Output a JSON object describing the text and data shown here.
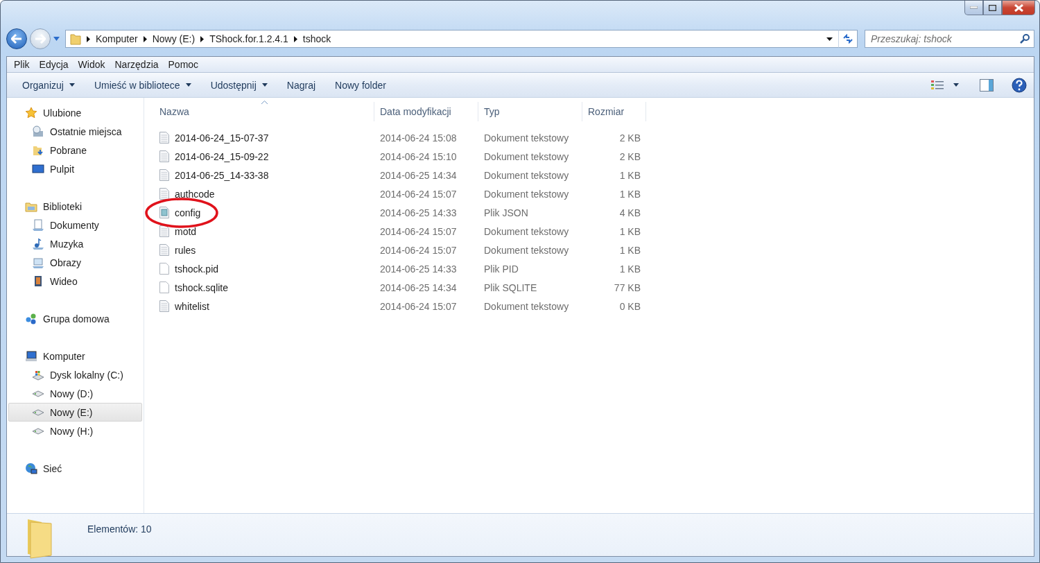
{
  "address_bar": {
    "breadcrumbs": [
      "Komputer",
      "Nowy (E:)",
      "TShock.for.1.2.4.1",
      "tshock"
    ]
  },
  "search": {
    "placeholder": "Przeszukaj: tshock"
  },
  "menu_bar": [
    "Plik",
    "Edycja",
    "Widok",
    "Narzędzia",
    "Pomoc"
  ],
  "toolbar": [
    {
      "label": "Organizuj",
      "dropdown": true
    },
    {
      "label": "Umieść w bibliotece",
      "dropdown": true
    },
    {
      "label": "Udostępnij",
      "dropdown": true
    },
    {
      "label": "Nagraj",
      "dropdown": false
    },
    {
      "label": "Nowy folder",
      "dropdown": false
    }
  ],
  "sidebar": {
    "groups": [
      {
        "label": "Ulubione",
        "kind": "star",
        "items": [
          {
            "label": "Ostatnie miejsca",
            "kind": "recent",
            "selected": false
          },
          {
            "label": "Pobrane",
            "kind": "download",
            "selected": false
          },
          {
            "label": "Pulpit",
            "kind": "desktop",
            "selected": false
          }
        ]
      },
      {
        "label": "Biblioteki",
        "kind": "library",
        "items": [
          {
            "label": "Dokumenty",
            "kind": "docs",
            "selected": false
          },
          {
            "label": "Muzyka",
            "kind": "music",
            "selected": false
          },
          {
            "label": "Obrazy",
            "kind": "pictures",
            "selected": false
          },
          {
            "label": "Wideo",
            "kind": "video",
            "selected": false
          }
        ]
      },
      {
        "label": "Grupa domowa",
        "kind": "homegroup"
      },
      {
        "label": "Komputer",
        "kind": "computer",
        "items": [
          {
            "label": "Dysk lokalny (C:)",
            "kind": "system-drive",
            "selected": false
          },
          {
            "label": "Nowy (D:)",
            "kind": "drive",
            "selected": false
          },
          {
            "label": "Nowy (E:)",
            "kind": "drive",
            "selected": true
          },
          {
            "label": "Nowy (H:)",
            "kind": "drive",
            "selected": false
          }
        ]
      },
      {
        "label": "Sieć",
        "kind": "network"
      }
    ]
  },
  "table": {
    "columns": [
      "Nazwa",
      "Data modyfikacji",
      "Typ",
      "Rozmiar"
    ],
    "rows": [
      {
        "name": "2014-06-24_15-07-37",
        "modified": "2014-06-24 15:08",
        "type": "Dokument tekstowy",
        "size": "2 KB",
        "kind": "text",
        "circled": false
      },
      {
        "name": "2014-06-24_15-09-22",
        "modified": "2014-06-24 15:10",
        "type": "Dokument tekstowy",
        "size": "2 KB",
        "kind": "text",
        "circled": false
      },
      {
        "name": "2014-06-25_14-33-38",
        "modified": "2014-06-25 14:34",
        "type": "Dokument tekstowy",
        "size": "1 KB",
        "kind": "text",
        "circled": false
      },
      {
        "name": "authcode",
        "modified": "2014-06-24 15:07",
        "type": "Dokument tekstowy",
        "size": "1 KB",
        "kind": "text",
        "circled": false
      },
      {
        "name": "config",
        "modified": "2014-06-25 14:33",
        "type": "Plik JSON",
        "size": "4 KB",
        "kind": "json",
        "circled": true
      },
      {
        "name": "motd",
        "modified": "2014-06-24 15:07",
        "type": "Dokument tekstowy",
        "size": "1 KB",
        "kind": "text",
        "circled": false
      },
      {
        "name": "rules",
        "modified": "2014-06-24 15:07",
        "type": "Dokument tekstowy",
        "size": "1 KB",
        "kind": "text",
        "circled": false
      },
      {
        "name": "tshock.pid",
        "modified": "2014-06-25 14:33",
        "type": "Plik PID",
        "size": "1 KB",
        "kind": "blank",
        "circled": false
      },
      {
        "name": "tshock.sqlite",
        "modified": "2014-06-25 14:34",
        "type": "Plik SQLITE",
        "size": "77 KB",
        "kind": "blank",
        "circled": false
      },
      {
        "name": "whitelist",
        "modified": "2014-06-24 15:07",
        "type": "Dokument tekstowy",
        "size": "0 KB",
        "kind": "text",
        "circled": false
      }
    ]
  },
  "status_bar": {
    "text": "Elementów: 10"
  }
}
